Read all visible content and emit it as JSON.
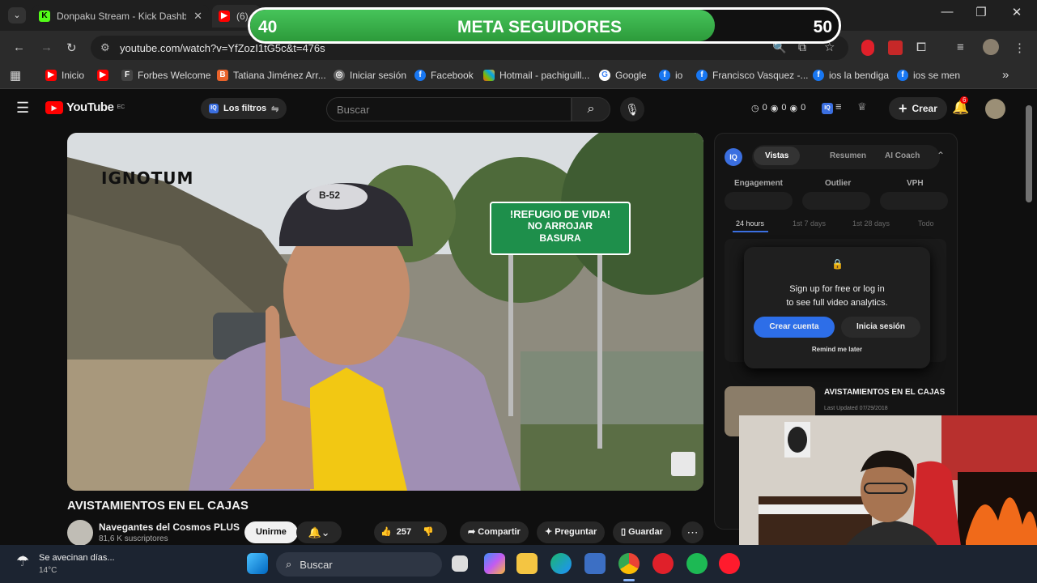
{
  "tabs": [
    {
      "title": "Donpaku Stream - Kick Dashbo",
      "favicon": "kick-icon"
    },
    {
      "title": "(6)",
      "favicon": "youtube-icon"
    }
  ],
  "address": {
    "url": "youtube.com/watch?v=YfZozI1tG5c&t=476s"
  },
  "bookmarks": [
    "Inicio",
    "Forbes Welcome",
    "Tatiana Jiménez Arr...",
    "Iniciar sesión",
    "Facebook",
    "Hotmail - pachiguill...",
    "Google",
    "io",
    "Francisco Vasquez -...",
    "ios la bendiga",
    "ios se men"
  ],
  "overlay": {
    "left_value": "40",
    "title": "META SEGUIDORES",
    "right_value": "50",
    "progress": 0.79
  },
  "youtube": {
    "logo": "YouTube",
    "country": "EC",
    "filter_label": "Los filtros",
    "search_placeholder": "Buscar",
    "stats": {
      "a": "0",
      "b": "0",
      "c": "0"
    },
    "create_label": "Crear",
    "notif_count": "6"
  },
  "video": {
    "watermark": "IGNOTUM",
    "sign_line1": "!REFUGIO DE VIDA!",
    "sign_line2": "NO ARROJAR",
    "sign_line3": "BASURA",
    "cap_text": "B-52",
    "title": "AVISTAMIENTOS EN EL CAJAS",
    "channel": "Navegantes del Cosmos PLUS",
    "subscribers": "81,6 K suscriptores",
    "join_label": "Unirme",
    "likes": "257",
    "share_label": "Compartir",
    "ask_label": "Preguntar",
    "save_label": "Guardar"
  },
  "analytics": {
    "logo": "IQ",
    "tabs": [
      "Vistas",
      "Resumen",
      "AI Coach"
    ],
    "metrics": [
      "Engagement",
      "Outlier",
      "VPH"
    ],
    "ranges": [
      "24 hours",
      "1st 7 days",
      "1st 28 days",
      "Todo"
    ],
    "lock_text1": "Sign up for free or log in",
    "lock_text2": "to see full video analytics.",
    "create_account": "Crear cuenta",
    "login": "Inicia sesión",
    "remind": "Remind me later",
    "related_title": "AVISTAMIENTOS EN EL CAJAS",
    "related_updated": "Last Updated 07/29/2018"
  },
  "taskbar": {
    "weather_title": "Se avecinan días...",
    "weather_temp": "14°C",
    "search_label": "Buscar"
  }
}
